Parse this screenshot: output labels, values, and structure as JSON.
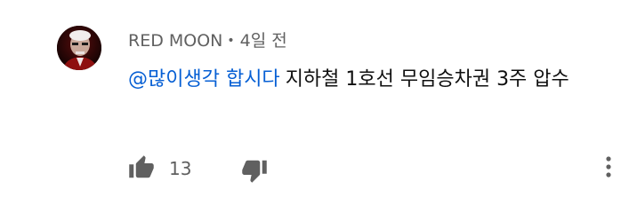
{
  "comment": {
    "author": "RED MOON",
    "separator": "•",
    "timestamp": "4일 전",
    "mention": "@많이생각 합시다",
    "text": "지하철 1호선 무임승차권 3주 압수",
    "like_count": "13"
  },
  "icons": {
    "avatar": "avatar-image",
    "like": "thumbs-up-icon",
    "dislike": "thumbs-down-icon",
    "more": "more-vertical-icon"
  },
  "colors": {
    "mention": "#065fd4",
    "meta": "#606060",
    "text": "#0f0f0f",
    "icon": "#606060"
  }
}
